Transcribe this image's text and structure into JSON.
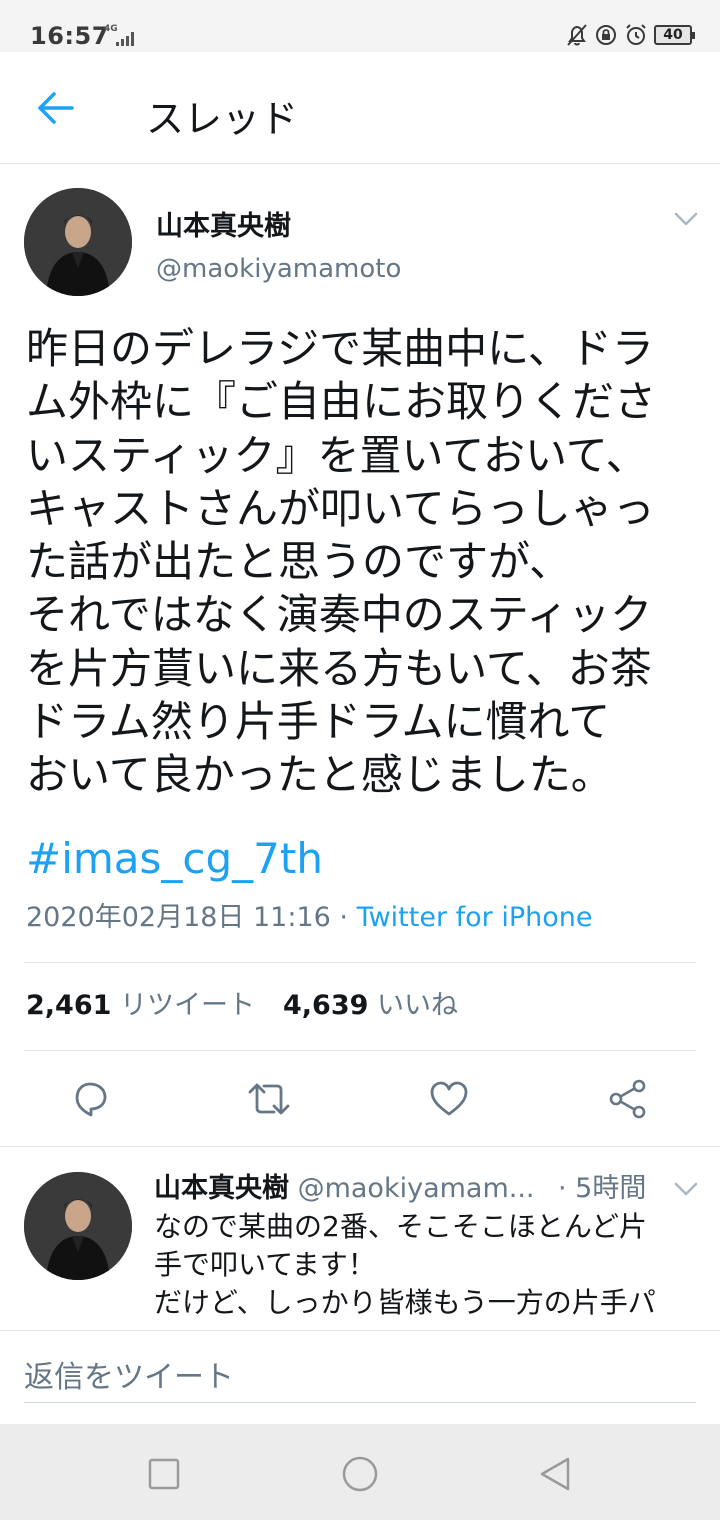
{
  "status_bar": {
    "time": "16:57",
    "network": "4G",
    "battery": "40",
    "icons": [
      "mute-bell-icon",
      "orientation-lock-icon",
      "alarm-icon",
      "battery-icon"
    ]
  },
  "header": {
    "title": "スレッド",
    "back_icon": "arrow-left-icon"
  },
  "tweet": {
    "author_name": "山本真央樹",
    "author_handle": "@maokiyamamoto",
    "text": "昨日のデレラジで某曲中に、ドラ\nム外枠に『ご自由にお取りくださ\nいスティック』を置いておいて、\nキャストさんが叩いてらっしゃっ\nた話が出たと思うのですが、\nそれではなく演奏中のスティック\nを片方貰いに来る方もいて、お茶\nドラム然り片手ドラムに慣れて\nおいて良かったと感じました。",
    "hashtag": "#imas_cg_7th",
    "timestamp": "2020年02月18日 11:16 · ",
    "source": "Twitter for iPhone",
    "retweets": "2,461",
    "retweets_label": " リツイート",
    "likes": "4,639",
    "likes_label": " いいね"
  },
  "actions": [
    "reply-icon",
    "retweet-icon",
    "like-icon",
    "share-icon"
  ],
  "reply": {
    "author_name": "山本真央樹",
    "author_handle": " @maokiyamam...",
    "time": "· 5時間",
    "text": "なので某曲の2番、そこそこほとんど片\n手で叩いてます！\nだけど、しっかり皆様もう一方の片手パ"
  },
  "compose": {
    "placeholder": "返信をツイート"
  },
  "nav": [
    "recent-apps-icon",
    "home-icon",
    "back-icon"
  ],
  "colors": {
    "accent": "#1da1f2",
    "secondary_text": "#657786",
    "primary_text": "#14171a",
    "divider": "#e1e8ed"
  }
}
